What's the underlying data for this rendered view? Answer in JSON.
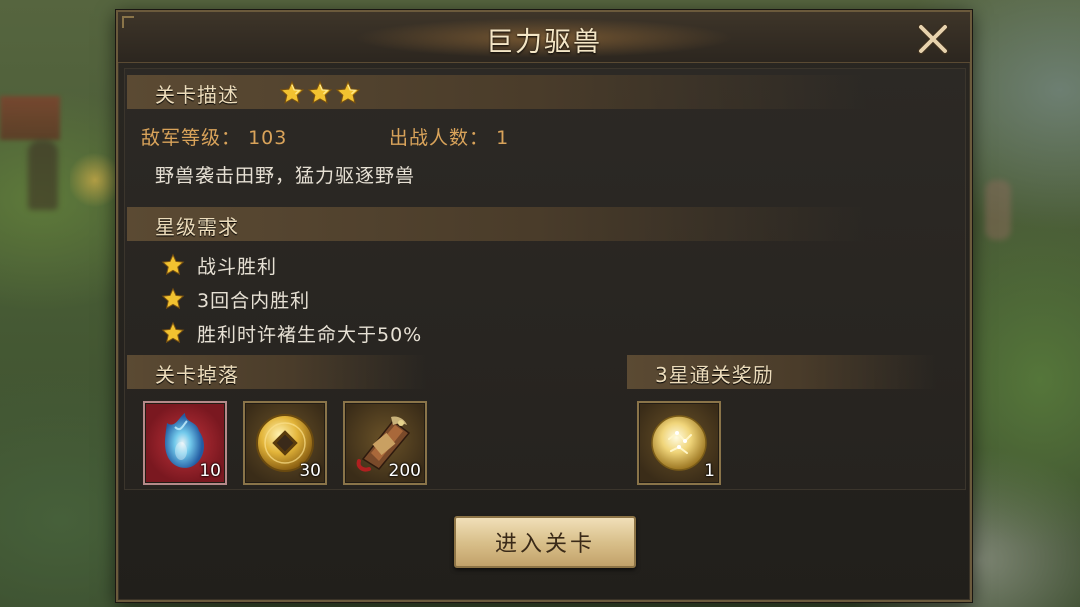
{
  "dialog": {
    "title": "巨力驱兽",
    "close_icon": "close-x-icon"
  },
  "stage_description": {
    "header": "关卡描述",
    "stars_earned": 3,
    "enemy_level_label": "敌军等级：",
    "enemy_level_value": "103",
    "battle_count_label": "出战人数：",
    "battle_count_value": "1",
    "description": "野兽袭击田野，猛力驱逐野兽"
  },
  "star_requirements": {
    "header": "星级需求",
    "items": [
      {
        "label": "战斗胜利",
        "icon": "star-icon"
      },
      {
        "label": "3回合内胜利",
        "icon": "star-icon"
      },
      {
        "label": "胜利时许褚生命大于50%",
        "icon": "star-icon"
      }
    ]
  },
  "stage_drops": {
    "header": "关卡掉落",
    "items": [
      {
        "icon": "blue-flame-gem-icon",
        "count": "10"
      },
      {
        "icon": "gold-coin-icon",
        "count": "30"
      },
      {
        "icon": "scroll-bundle-icon",
        "count": "200"
      }
    ]
  },
  "three_star_reward": {
    "header": "3星通关奖励",
    "items": [
      {
        "icon": "golden-orb-icon",
        "count": "1"
      }
    ]
  },
  "enter_button": {
    "label": "进入关卡"
  },
  "colors": {
    "accent_gold": "#d9a35a",
    "title_text": "#f4e6c6",
    "button_bg": "#d9c08b"
  }
}
